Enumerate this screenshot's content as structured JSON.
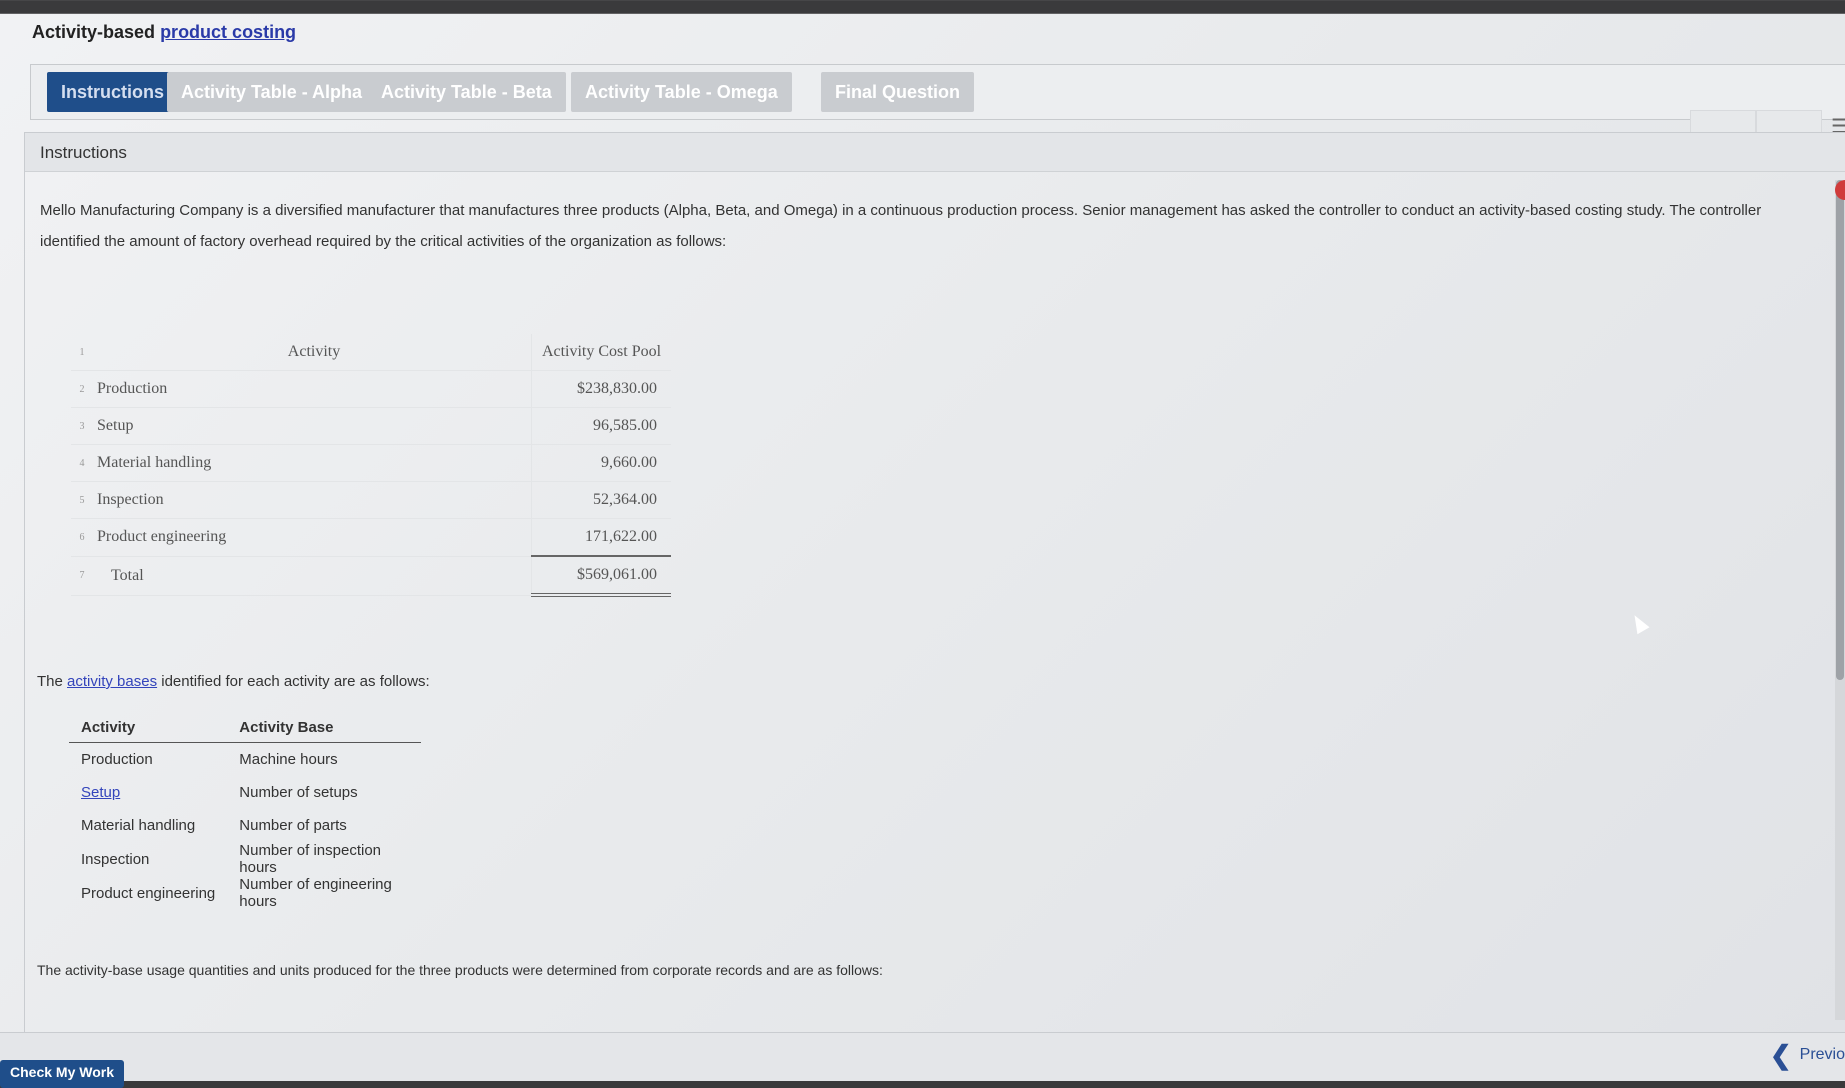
{
  "header": {
    "title_prefix": "Activity-based",
    "title_link": "product costing"
  },
  "tabs": [
    {
      "label": "Instructions",
      "active": true
    },
    {
      "label": "Activity Table - Alpha",
      "active": false
    },
    {
      "label": "Activity Table - Beta",
      "active": false
    },
    {
      "label": "Activity Table - Omega",
      "active": false
    },
    {
      "label": "Final Question",
      "active": false
    }
  ],
  "panel": {
    "title": "Instructions",
    "intro": "Mello Manufacturing Company is a diversified manufacturer that manufactures three products (Alpha, Beta, and Omega) in a continuous production process. Senior management has asked the controller to conduct an activity-based costing study. The controller identified the amount of factory overhead required by the critical activities of the organization as follows:",
    "cost_table": {
      "header_row": "1",
      "col_activity": "Activity",
      "col_pool": "Activity Cost Pool",
      "rows": [
        {
          "n": "2",
          "activity": "Production",
          "pool": "$238,830.00"
        },
        {
          "n": "3",
          "activity": "Setup",
          "pool": "96,585.00"
        },
        {
          "n": "4",
          "activity": "Material handling",
          "pool": "9,660.00"
        },
        {
          "n": "5",
          "activity": "Inspection",
          "pool": "52,364.00"
        },
        {
          "n": "6",
          "activity": "Product engineering",
          "pool": "171,622.00"
        }
      ],
      "total": {
        "n": "7",
        "activity": "Total",
        "pool": "$569,061.00"
      }
    },
    "bases_intro_pre": "The",
    "bases_intro_link": "activity bases",
    "bases_intro_post": "identified for each activity are as follows:",
    "bases_table": {
      "col_activity": "Activity",
      "col_base": "Activity Base",
      "rows": [
        {
          "activity": "Production",
          "base": "Machine hours"
        },
        {
          "activity": "Setup",
          "base": "Number of setups"
        },
        {
          "activity": "Material handling",
          "base": "Number of parts"
        },
        {
          "activity": "Inspection",
          "base": "Number of inspection hours"
        },
        {
          "activity": "Product engineering",
          "base": "Number of engineering hours"
        }
      ]
    },
    "usage_intro": "The activity-base usage quantities and units produced for the three products were determined from corporate records and are as follows:"
  },
  "footer": {
    "check_label": "Check My Work",
    "prev_label": "Previo"
  },
  "colors": {
    "accent": "#1f4e8a",
    "link": "#3344bb"
  }
}
